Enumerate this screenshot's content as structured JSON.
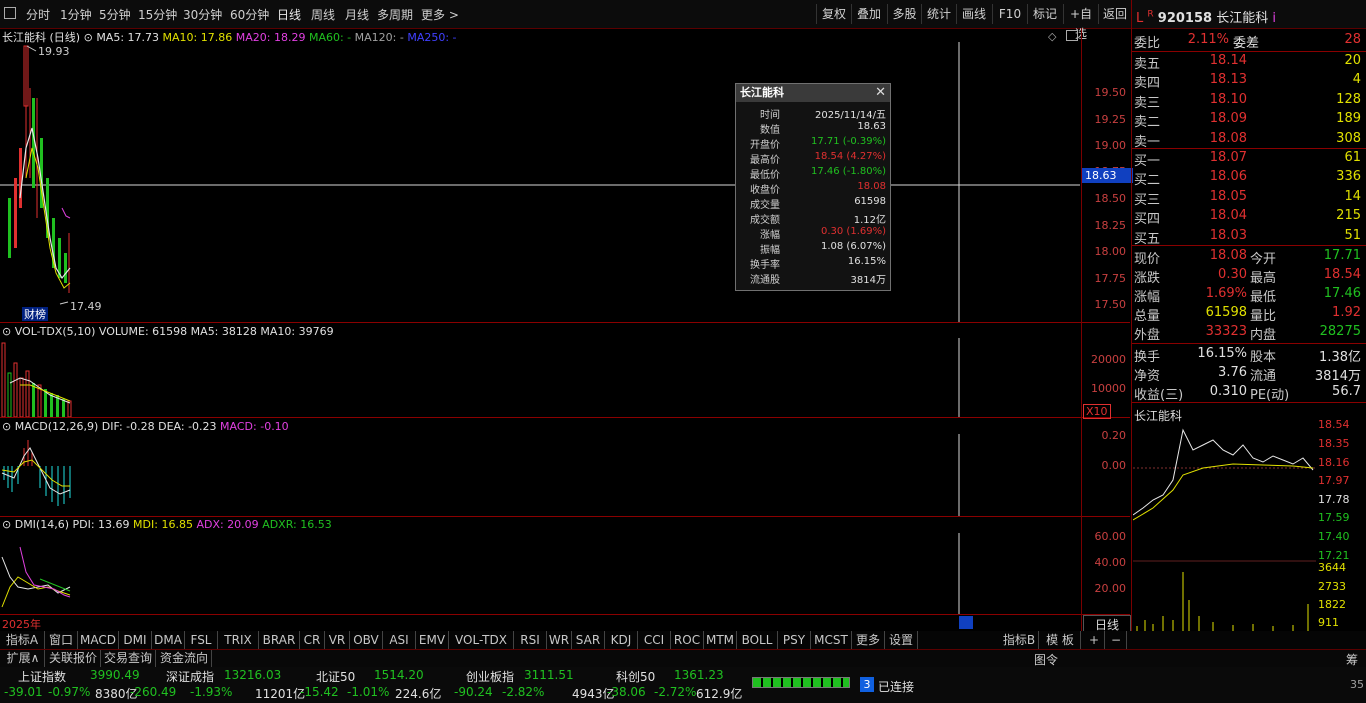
{
  "toolbar": {
    "periods": [
      "分时",
      "1分钟",
      "5分钟",
      "15分钟",
      "30分钟",
      "60分钟",
      "日线",
      "周线",
      "月线",
      "多周期",
      "更多 >"
    ],
    "active_period": "日线",
    "buttons": [
      "复权",
      "叠加",
      "多股",
      "统计",
      "画线",
      "F10",
      "标记",
      "+自选",
      "返回"
    ]
  },
  "main_chart": {
    "title": "长江能科 (日线)",
    "ma5": "MA5: 17.73",
    "ma10": "MA10: 17.86",
    "ma20": "MA20: 18.29",
    "ma60": "MA60: -",
    "ma120": "MA120: -",
    "ma250": "MA250: -",
    "high_label": "19.93",
    "low_label": "17.49",
    "badge": "财榜",
    "crosshair_value": "18.63",
    "y_ticks": [
      "19.50",
      "19.25",
      "19.00",
      "18.75",
      "18.50",
      "18.25",
      "18.00",
      "17.75",
      "17.50"
    ]
  },
  "tooltip": {
    "title": "长江能科",
    "rows": [
      {
        "k": "时间",
        "v": "2025/11/14/五",
        "c": "white"
      },
      {
        "k": "数值",
        "v": "18.63",
        "c": "white"
      },
      {
        "k": "开盘价",
        "v": "17.71 (-0.39%)",
        "c": "green"
      },
      {
        "k": "最高价",
        "v": "18.54 (4.27%)",
        "c": "red"
      },
      {
        "k": "最低价",
        "v": "17.46 (-1.80%)",
        "c": "green"
      },
      {
        "k": "收盘价",
        "v": "18.08",
        "c": "red"
      },
      {
        "k": "成交量",
        "v": "61598",
        "c": "white"
      },
      {
        "k": "成交额",
        "v": "1.12亿",
        "c": "white"
      },
      {
        "k": "涨幅",
        "v": "0.30 (1.69%)",
        "c": "red"
      },
      {
        "k": "振幅",
        "v": "1.08 (6.07%)",
        "c": "white"
      },
      {
        "k": "换手率",
        "v": "16.15%",
        "c": "white"
      },
      {
        "k": "流通股",
        "v": "3814万",
        "c": "white"
      }
    ]
  },
  "vol_panel": {
    "title": "VOL-TDX(5,10)",
    "volume": "VOLUME: 61598",
    "ma5": "MA5: 38128",
    "ma10": "MA10: 39769",
    "y_ticks": [
      "20000",
      "10000"
    ],
    "unit": "X10"
  },
  "macd_panel": {
    "title": "MACD(12,26,9)",
    "dif": "DIF: -0.28",
    "dea": "DEA: -0.23",
    "macd": "MACD: -0.10",
    "y_ticks": [
      "0.20",
      "0.00"
    ]
  },
  "dmi_panel": {
    "title": "DMI(14,6)",
    "pdi": "PDI: 13.69",
    "mdi": "MDI: 16.85",
    "adx": "ADX: 20.09",
    "adxr": "ADXR: 16.53",
    "y_ticks": [
      "60.00",
      "40.00",
      "20.00"
    ]
  },
  "x_axis": {
    "year": "2025年",
    "period_btn": "日线"
  },
  "quote": {
    "l": "L",
    "r": "R",
    "code": "920158",
    "name": "长江能科",
    "info": "i",
    "weibi": {
      "l": "委比",
      "v": "2.11%",
      "m": "委差",
      "n": "28"
    },
    "asks": [
      {
        "l": "卖五",
        "p": "18.14",
        "n": "20"
      },
      {
        "l": "卖四",
        "p": "18.13",
        "n": "4"
      },
      {
        "l": "卖三",
        "p": "18.10",
        "n": "128"
      },
      {
        "l": "卖二",
        "p": "18.09",
        "n": "189"
      },
      {
        "l": "卖一",
        "p": "18.08",
        "n": "308"
      }
    ],
    "bids": [
      {
        "l": "买一",
        "p": "18.07",
        "n": "61"
      },
      {
        "l": "买二",
        "p": "18.06",
        "n": "336"
      },
      {
        "l": "买三",
        "p": "18.05",
        "n": "14"
      },
      {
        "l": "买四",
        "p": "18.04",
        "n": "215"
      },
      {
        "l": "买五",
        "p": "18.03",
        "n": "51"
      }
    ],
    "stats": [
      {
        "l1": "现价",
        "v1": "18.08",
        "c1": "red",
        "l2": "今开",
        "v2": "17.71",
        "c2": "green"
      },
      {
        "l1": "涨跌",
        "v1": "0.30",
        "c1": "red",
        "l2": "最高",
        "v2": "18.54",
        "c2": "red"
      },
      {
        "l1": "涨幅",
        "v1": "1.69%",
        "c1": "red",
        "l2": "最低",
        "v2": "17.46",
        "c2": "green"
      },
      {
        "l1": "总量",
        "v1": "61598",
        "c1": "yellow",
        "l2": "量比",
        "v2": "1.92",
        "c2": "red"
      },
      {
        "l1": "外盘",
        "v1": "33323",
        "c1": "red",
        "l2": "内盘",
        "v2": "28275",
        "c2": "green"
      }
    ],
    "fund": [
      {
        "l1": "换手",
        "v1": "16.15%",
        "l2": "股本",
        "v2": "1.38亿"
      },
      {
        "l1": "净资",
        "v1": "3.76",
        "l2": "流通",
        "v2": "3814万"
      },
      {
        "l1": "收益(三)",
        "v1": "0.310",
        "l2": "PE(动)",
        "v2": "56.7"
      }
    ],
    "mini_title": "长江能科",
    "mini_ticks": [
      "18.54",
      "18.35",
      "18.16",
      "17.97",
      "17.78",
      "17.59",
      "17.40",
      "17.21",
      "3644",
      "2733",
      "1822",
      "911"
    ]
  },
  "tabs": [
    "指标A",
    "窗口",
    "MACD",
    "DMI",
    "DMA",
    "FSL",
    "TRIX",
    "BRAR",
    "CR",
    "VR",
    "OBV",
    "ASI",
    "EMV",
    "VOL-TDX",
    "RSI",
    "WR",
    "SAR",
    "KDJ",
    "CCI",
    "ROC",
    "MTM",
    "BOLL",
    "PSY",
    "MCST",
    "更多",
    "设置"
  ],
  "tabs_right": [
    "指标B",
    "模 板",
    "+",
    "−"
  ],
  "sub_tabs": [
    "扩展∧",
    "关联报价",
    "交易查询",
    "资金流向"
  ],
  "sub_right": {
    "left": "图令",
    "right": "筹"
  },
  "indices": [
    {
      "name": "上证指数",
      "val": "3990.49",
      "chg": "-39.01",
      "pct": "-0.97%",
      "amt": "8380亿"
    },
    {
      "name": "深证成指",
      "val": "13216.03",
      "chg": "-260.49",
      "pct": "-1.93%",
      "amt": "11201亿"
    },
    {
      "name": "北证50",
      "val": "1514.20",
      "chg": "-15.42",
      "pct": "-1.01%",
      "amt": "224.6亿"
    },
    {
      "name": "创业板指",
      "val": "3111.51",
      "chg": "-90.24",
      "pct": "-2.82%",
      "amt": "4943亿"
    },
    {
      "name": "科创50",
      "val": "1361.23",
      "chg": "-38.06",
      "pct": "-2.72%",
      "amt": "612.9亿"
    }
  ],
  "connection": {
    "count": "3",
    "text": "已连接"
  },
  "corner_num": "35"
}
